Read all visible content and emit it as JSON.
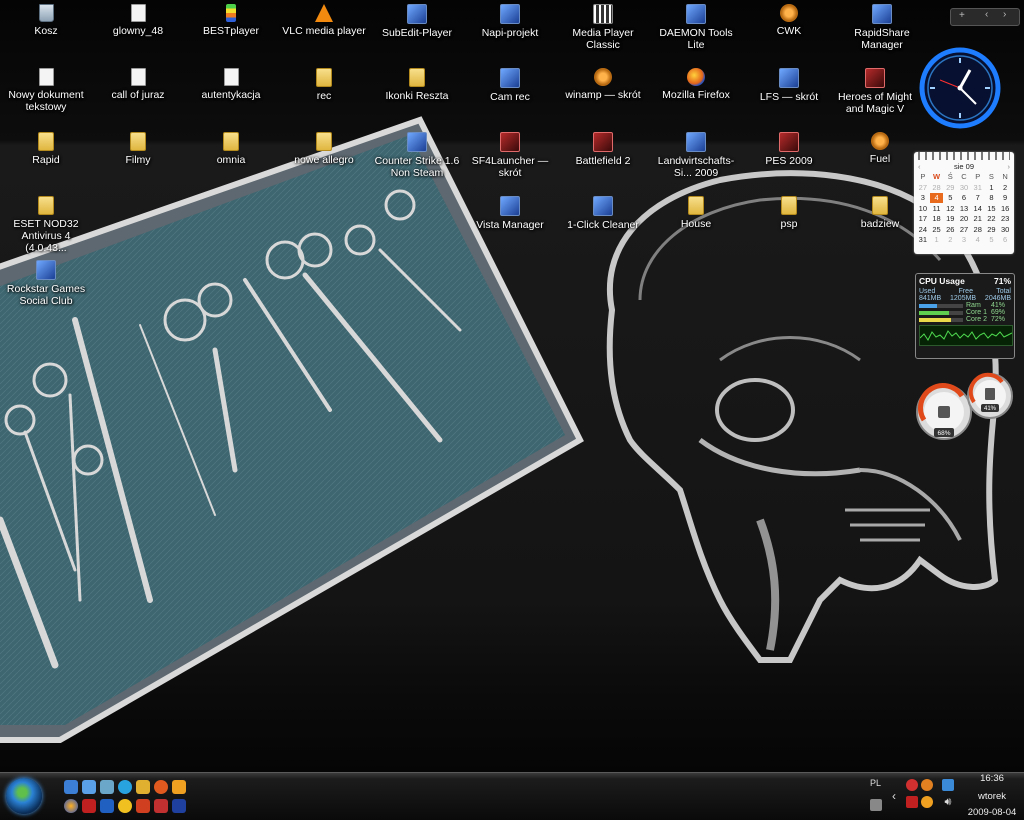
{
  "desktop": {
    "icons": [
      {
        "label": "Kosz",
        "icon": "recycle-bin-icon"
      },
      {
        "label": "glowny_48",
        "icon": "image-file-icon"
      },
      {
        "label": "BESTplayer",
        "icon": "bestplayer-icon"
      },
      {
        "label": "VLC media player",
        "icon": "vlc-icon"
      },
      {
        "label": "SubEdit-Player",
        "icon": "subedit-icon"
      },
      {
        "label": "Napi-projekt",
        "icon": "napiprojekt-icon"
      },
      {
        "label": "Media Player Classic",
        "icon": "media-player-classic-icon"
      },
      {
        "label": "DAEMON Tools Lite",
        "icon": "daemon-tools-icon"
      },
      {
        "label": "CWK",
        "icon": "cwk-icon"
      },
      {
        "label": "RapidShare Manager",
        "icon": "rapidshare-icon"
      },
      {
        "label": "Nowy dokument tekstowy",
        "icon": "text-document-icon"
      },
      {
        "label": "call of juraz",
        "icon": "text-document-icon"
      },
      {
        "label": "autentykacja",
        "icon": "text-document-icon"
      },
      {
        "label": "rec",
        "icon": "folder-icon"
      },
      {
        "label": "Ikonki Reszta",
        "icon": "folder-icon"
      },
      {
        "label": "Cam rec",
        "icon": "shortcut-icon"
      },
      {
        "label": "winamp — skrót",
        "icon": "winamp-icon"
      },
      {
        "label": "Mozilla Firefox",
        "icon": "firefox-icon"
      },
      {
        "label": "LFS — skrót",
        "icon": "lfs-icon"
      },
      {
        "label": "Heroes of Might and Magic V",
        "icon": "heroes-icon"
      },
      {
        "label": "Rapid",
        "icon": "folder-icon"
      },
      {
        "label": "Filmy",
        "icon": "folder-icon"
      },
      {
        "label": "omnia",
        "icon": "folder-icon"
      },
      {
        "label": "nowe allegro",
        "icon": "folder-icon"
      },
      {
        "label": "Counter Strike 1.6 Non Steam",
        "icon": "counter-strike-icon"
      },
      {
        "label": "SF4Launcher — skrót",
        "icon": "sf4-icon"
      },
      {
        "label": "Battlefield 2",
        "icon": "battlefield-icon"
      },
      {
        "label": "Landwirtschafts-Si... 2009",
        "icon": "landwirtschafts-icon"
      },
      {
        "label": "PES 2009",
        "icon": "pes-icon"
      },
      {
        "label": "Fuel",
        "icon": "fuel-icon"
      },
      {
        "label": "ESET NOD32 Antivirus 4 (4.0.43...",
        "icon": "eset-icon"
      },
      {
        "label": "Vista Manager",
        "icon": "vista-manager-icon"
      },
      {
        "label": "1-Click Cleaner",
        "icon": "cleaner-icon"
      },
      {
        "label": "House",
        "icon": "folder-icon"
      },
      {
        "label": "psp",
        "icon": "folder-icon"
      },
      {
        "label": "badziew",
        "icon": "folder-icon"
      },
      {
        "label": "Rockstar Games Social Club",
        "icon": "rockstar-icon"
      }
    ]
  },
  "sidebar_gadgets": {
    "control_plus": "+",
    "control_prev": "‹",
    "control_next": "›",
    "calendar": {
      "prev": "‹",
      "month": "sie 09",
      "next": "›",
      "days_of_week": [
        "P",
        "W",
        "Ś",
        "C",
        "P",
        "S",
        "N"
      ],
      "weeks": [
        [
          "27",
          "28",
          "29",
          "30",
          "31",
          "1",
          "2"
        ],
        [
          "3",
          "4",
          "5",
          "6",
          "7",
          "8",
          "9"
        ],
        [
          "10",
          "11",
          "12",
          "13",
          "14",
          "15",
          "16"
        ],
        [
          "17",
          "18",
          "19",
          "20",
          "21",
          "22",
          "23"
        ],
        [
          "24",
          "25",
          "26",
          "27",
          "28",
          "29",
          "30"
        ],
        [
          "31",
          "1",
          "2",
          "3",
          "4",
          "5",
          "6"
        ]
      ],
      "today": "4"
    },
    "cpu": {
      "title": "CPU Usage",
      "percent": "71%",
      "headers": [
        "Used",
        "Free",
        "Total"
      ],
      "values": [
        "841MB",
        "1205MB",
        "2046MB"
      ],
      "rows": [
        {
          "label": "Ram",
          "percent": "41%",
          "level": 0.41,
          "color": "#4aa3e8"
        },
        {
          "label": "Core 1",
          "percent": "69%",
          "level": 0.69,
          "color": "#5fcf4f"
        },
        {
          "label": "Core 2",
          "percent": "72%",
          "level": 0.72,
          "color": "#e8d84a"
        }
      ]
    },
    "meters": {
      "left": "68%",
      "right": "41%"
    }
  },
  "taskbar": {
    "language": "PL",
    "time": "16:36",
    "day": "wtorek",
    "date": "2009-08-04"
  },
  "colors": {
    "accent_blue": "#1e7dff",
    "calendar_today": "#e86a1c"
  }
}
